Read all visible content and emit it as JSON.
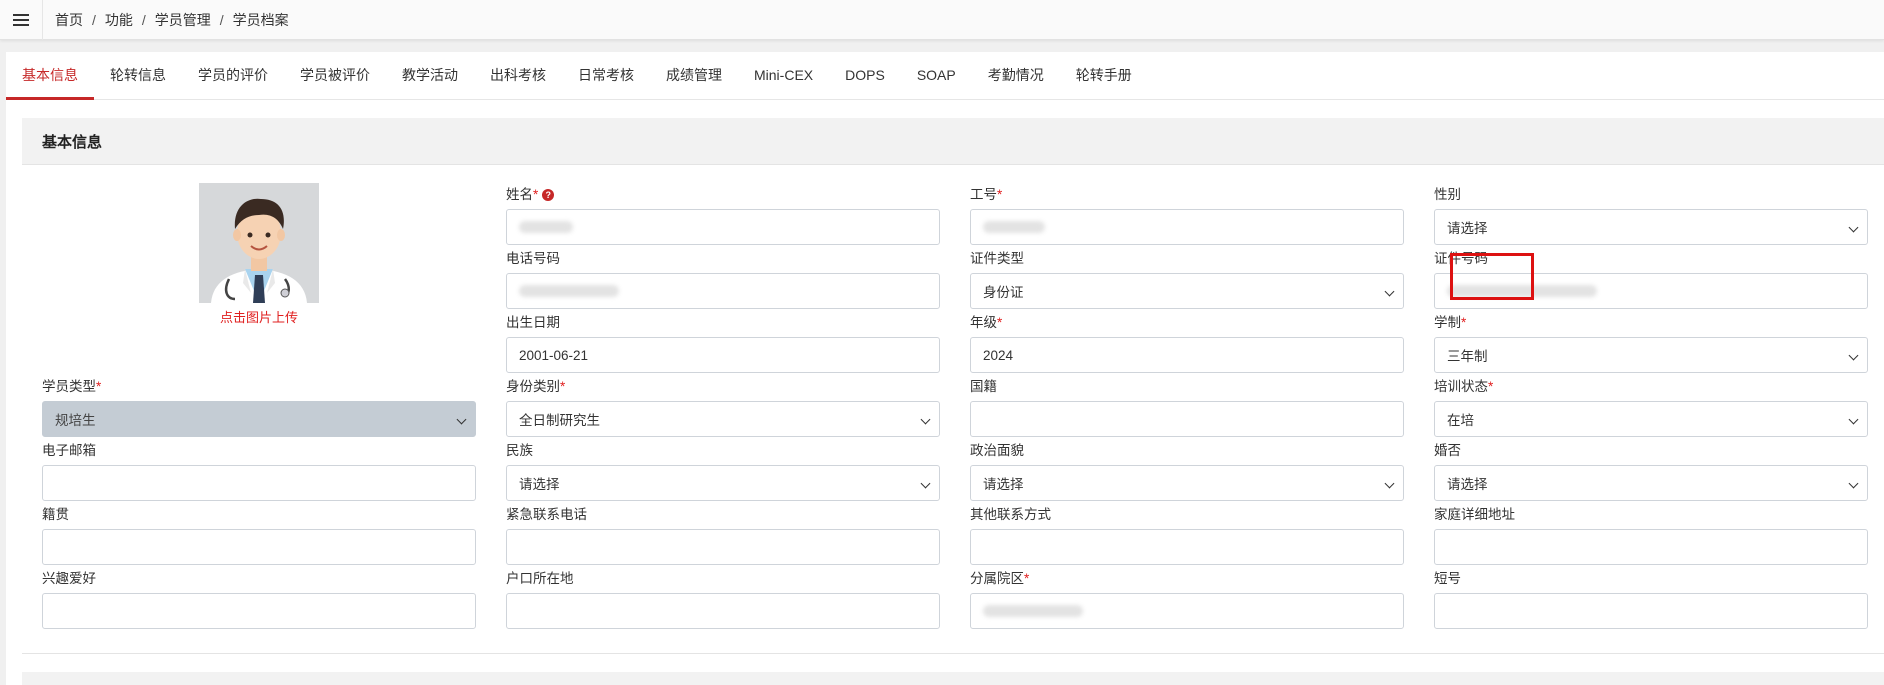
{
  "breadcrumb": [
    "首页",
    "功能",
    "学员管理",
    "学员档案"
  ],
  "tabs": [
    {
      "label": "基本信息",
      "active": true
    },
    {
      "label": "轮转信息"
    },
    {
      "label": "学员的评价"
    },
    {
      "label": "学员被评价"
    },
    {
      "label": "教学活动"
    },
    {
      "label": "出科考核"
    },
    {
      "label": "日常考核"
    },
    {
      "label": "成绩管理"
    },
    {
      "label": "Mini-CEX"
    },
    {
      "label": "DOPS"
    },
    {
      "label": "SOAP"
    },
    {
      "label": "考勤情况"
    },
    {
      "label": "轮转手册"
    }
  ],
  "section": {
    "title": "基本信息"
  },
  "photo": {
    "upload_label": "点击图片上传"
  },
  "fields": {
    "name": {
      "label": "姓名",
      "value": ""
    },
    "work_id": {
      "label": "工号",
      "value": ""
    },
    "gender": {
      "label": "性别",
      "value": "请选择"
    },
    "phone": {
      "label": "电话号码",
      "value": ""
    },
    "id_type": {
      "label": "证件类型",
      "value": "身份证"
    },
    "id_number": {
      "label": "证件号码",
      "value": ""
    },
    "birth_date": {
      "label": "出生日期",
      "value": "2001-06-21"
    },
    "grade": {
      "label": "年级",
      "value": "2024"
    },
    "schooling": {
      "label": "学制",
      "value": "三年制"
    },
    "student_type": {
      "label": "学员类型",
      "value": "规培生"
    },
    "identity_category": {
      "label": "身份类别",
      "value": "全日制研究生"
    },
    "nationality": {
      "label": "国籍",
      "value": ""
    },
    "training_status": {
      "label": "培训状态",
      "value": "在培"
    },
    "email": {
      "label": "电子邮箱",
      "value": ""
    },
    "ethnicity": {
      "label": "民族",
      "value": "请选择"
    },
    "political_status": {
      "label": "政治面貌",
      "value": "请选择"
    },
    "marital_status": {
      "label": "婚否",
      "value": "请选择"
    },
    "native_place": {
      "label": "籍贯",
      "value": ""
    },
    "emergency_phone": {
      "label": "紧急联系电话",
      "value": ""
    },
    "other_contact": {
      "label": "其他联系方式",
      "value": ""
    },
    "home_address": {
      "label": "家庭详细地址",
      "value": ""
    },
    "hobbies": {
      "label": "兴趣爱好",
      "value": ""
    },
    "household_location": {
      "label": "户口所在地",
      "value": ""
    },
    "branch_hospital": {
      "label": "分属院区",
      "value": ""
    },
    "short_number": {
      "label": "短号",
      "value": ""
    }
  },
  "colors": {
    "accent": "#c62828",
    "required": "#e02020",
    "highlight_box": "#dd1111"
  }
}
